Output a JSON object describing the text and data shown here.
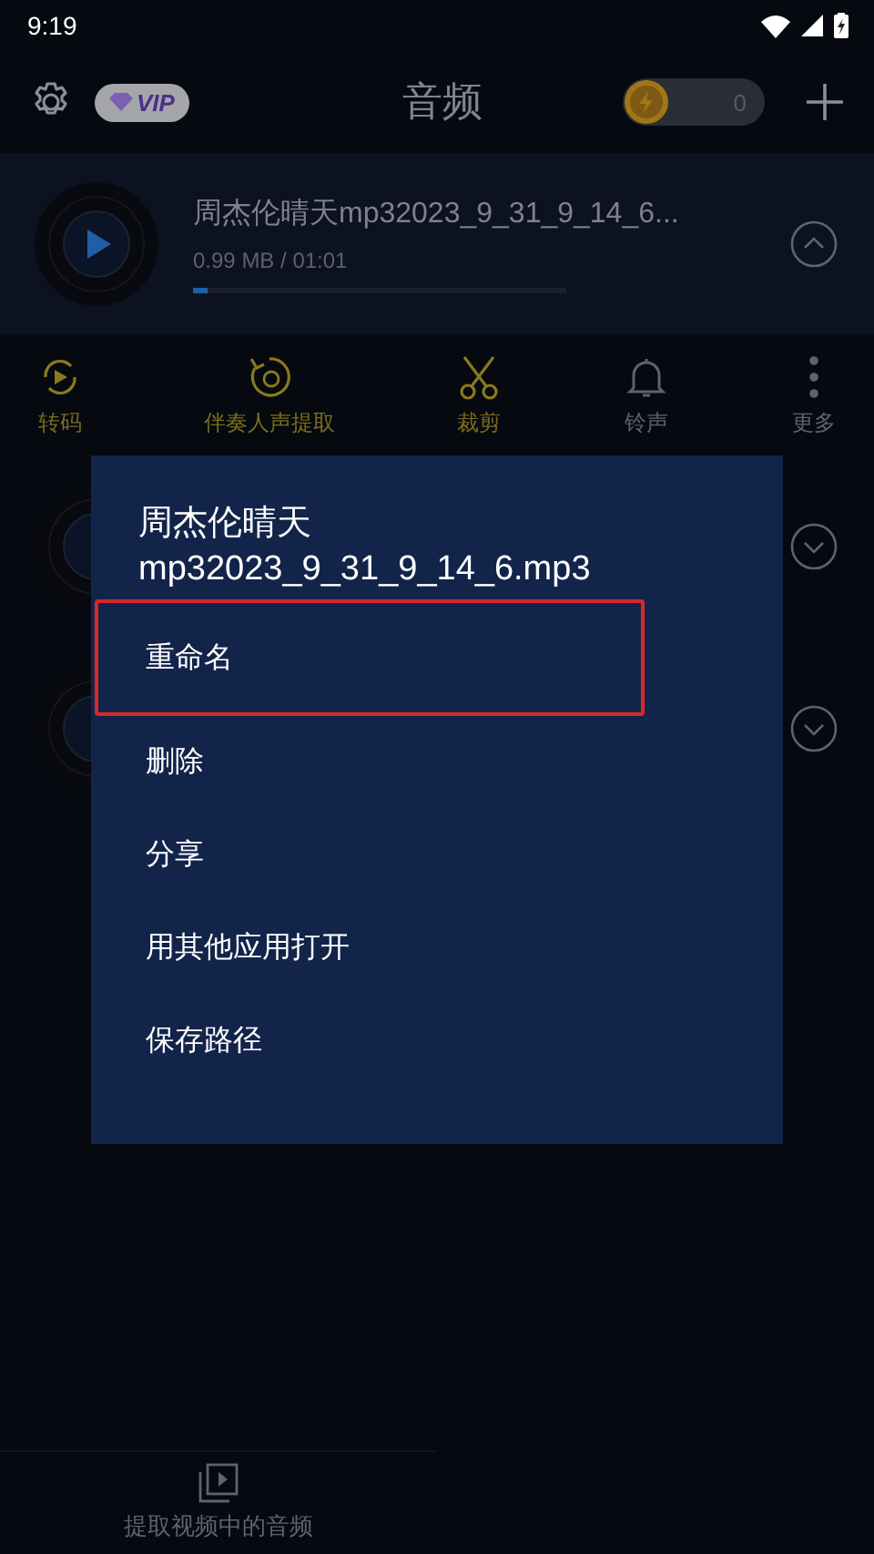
{
  "status_bar": {
    "time": "9:19"
  },
  "header": {
    "title": "音频",
    "vip": "VIP",
    "coins": "0"
  },
  "tracks": [
    {
      "name": "周杰伦晴天mp32023_9_31_9_14_6...",
      "info": "0.99 MB / 01:01",
      "level": 0.04,
      "expanded": true
    },
    {
      "expanded": false
    },
    {
      "expanded": false
    }
  ],
  "actions": [
    {
      "kind": "convert",
      "label": "转码"
    },
    {
      "kind": "vocal",
      "label": "伴奏人声提取"
    },
    {
      "kind": "cut",
      "label": "裁剪"
    },
    {
      "kind": "ringtone",
      "label": "铃声"
    },
    {
      "kind": "more",
      "label": "更多"
    }
  ],
  "dialog": {
    "title": "周杰伦晴天mp32023_9_31_9_14_6.mp3",
    "items": [
      {
        "label": "重命名",
        "selected": true
      },
      {
        "label": "删除",
        "selected": false
      },
      {
        "label": "分享",
        "selected": false
      },
      {
        "label": "用其他应用打开",
        "selected": false
      },
      {
        "label": "保存路径",
        "selected": false
      }
    ]
  },
  "bottom_nav": {
    "label": "提取视频中的音频"
  }
}
